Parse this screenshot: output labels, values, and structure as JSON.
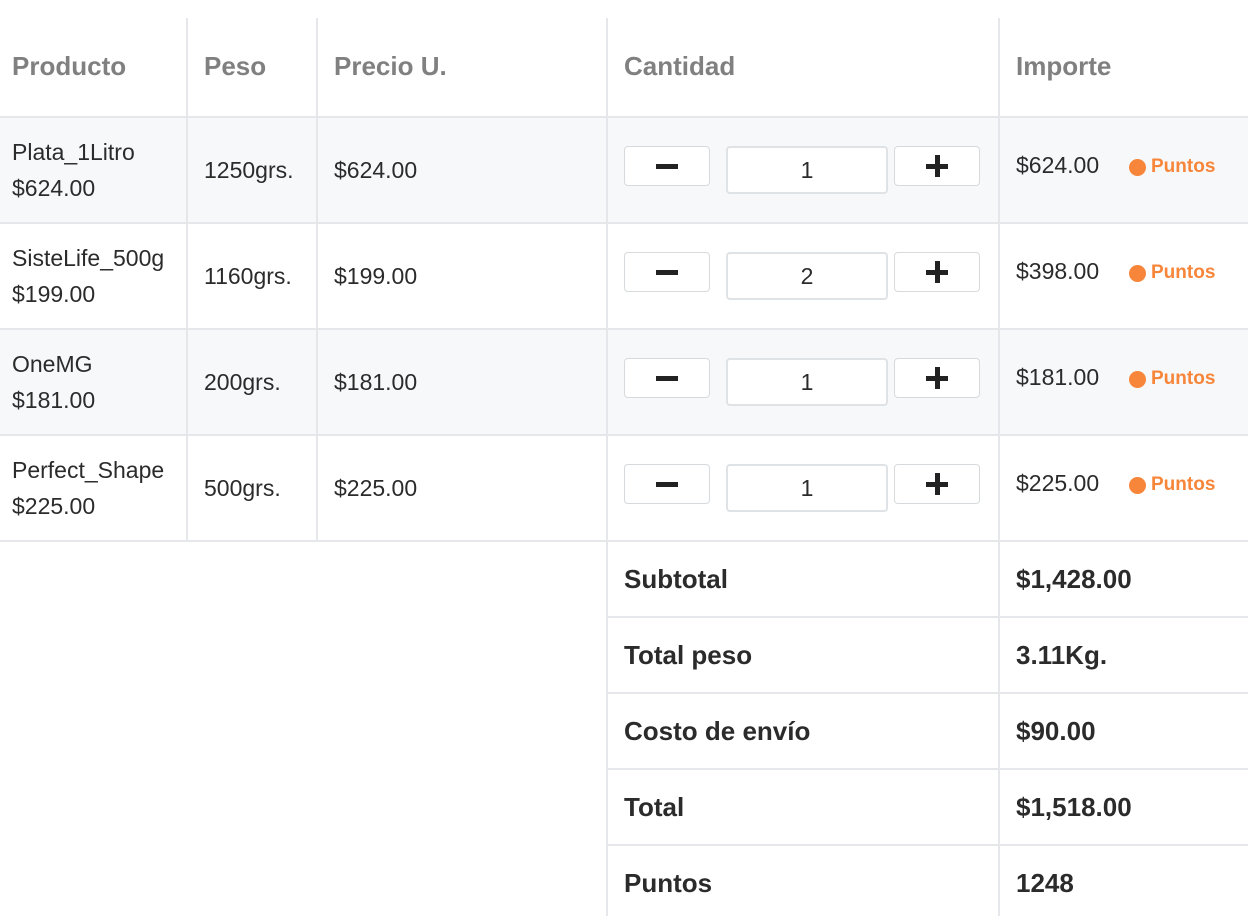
{
  "headers": {
    "producto": "Producto",
    "peso": "Peso",
    "precio": "Precio U.",
    "cantidad": "Cantidad",
    "importe": "Importe"
  },
  "items": [
    {
      "name": "Plata_1Litro",
      "price_sub": "$624.00",
      "peso": "1250grs.",
      "precio": "$624.00",
      "cantidad": "1",
      "importe": "$624.00",
      "badge": "Puntos"
    },
    {
      "name": "SisteLife_500g",
      "price_sub": "$199.00",
      "peso": "1160grs.",
      "precio": "$199.00",
      "cantidad": "2",
      "importe": "$398.00",
      "badge": "Puntos"
    },
    {
      "name": "OneMG",
      "price_sub": "$181.00",
      "peso": "200grs.",
      "precio": "$181.00",
      "cantidad": "1",
      "importe": "$181.00",
      "badge": "Puntos"
    },
    {
      "name": "Perfect_Shape",
      "price_sub": "$225.00",
      "peso": "500grs.",
      "precio": "$225.00",
      "cantidad": "1",
      "importe": "$225.00",
      "badge": "Puntos"
    }
  ],
  "summary": [
    {
      "label": "Subtotal",
      "value": "$1,428.00"
    },
    {
      "label": "Total peso",
      "value": "3.11Kg."
    },
    {
      "label": "Costo de envío",
      "value": "$90.00"
    },
    {
      "label": "Total",
      "value": "$1,518.00"
    },
    {
      "label": "Puntos",
      "value": "1248"
    }
  ],
  "icons": {
    "decrement": "minus-icon",
    "increment": "plus-icon",
    "badge": "dot-icon"
  },
  "colors": {
    "accent": "#f7863a",
    "header_text": "#808080",
    "row_shade": "#f7f8fa",
    "border": "#e5e7ea"
  }
}
